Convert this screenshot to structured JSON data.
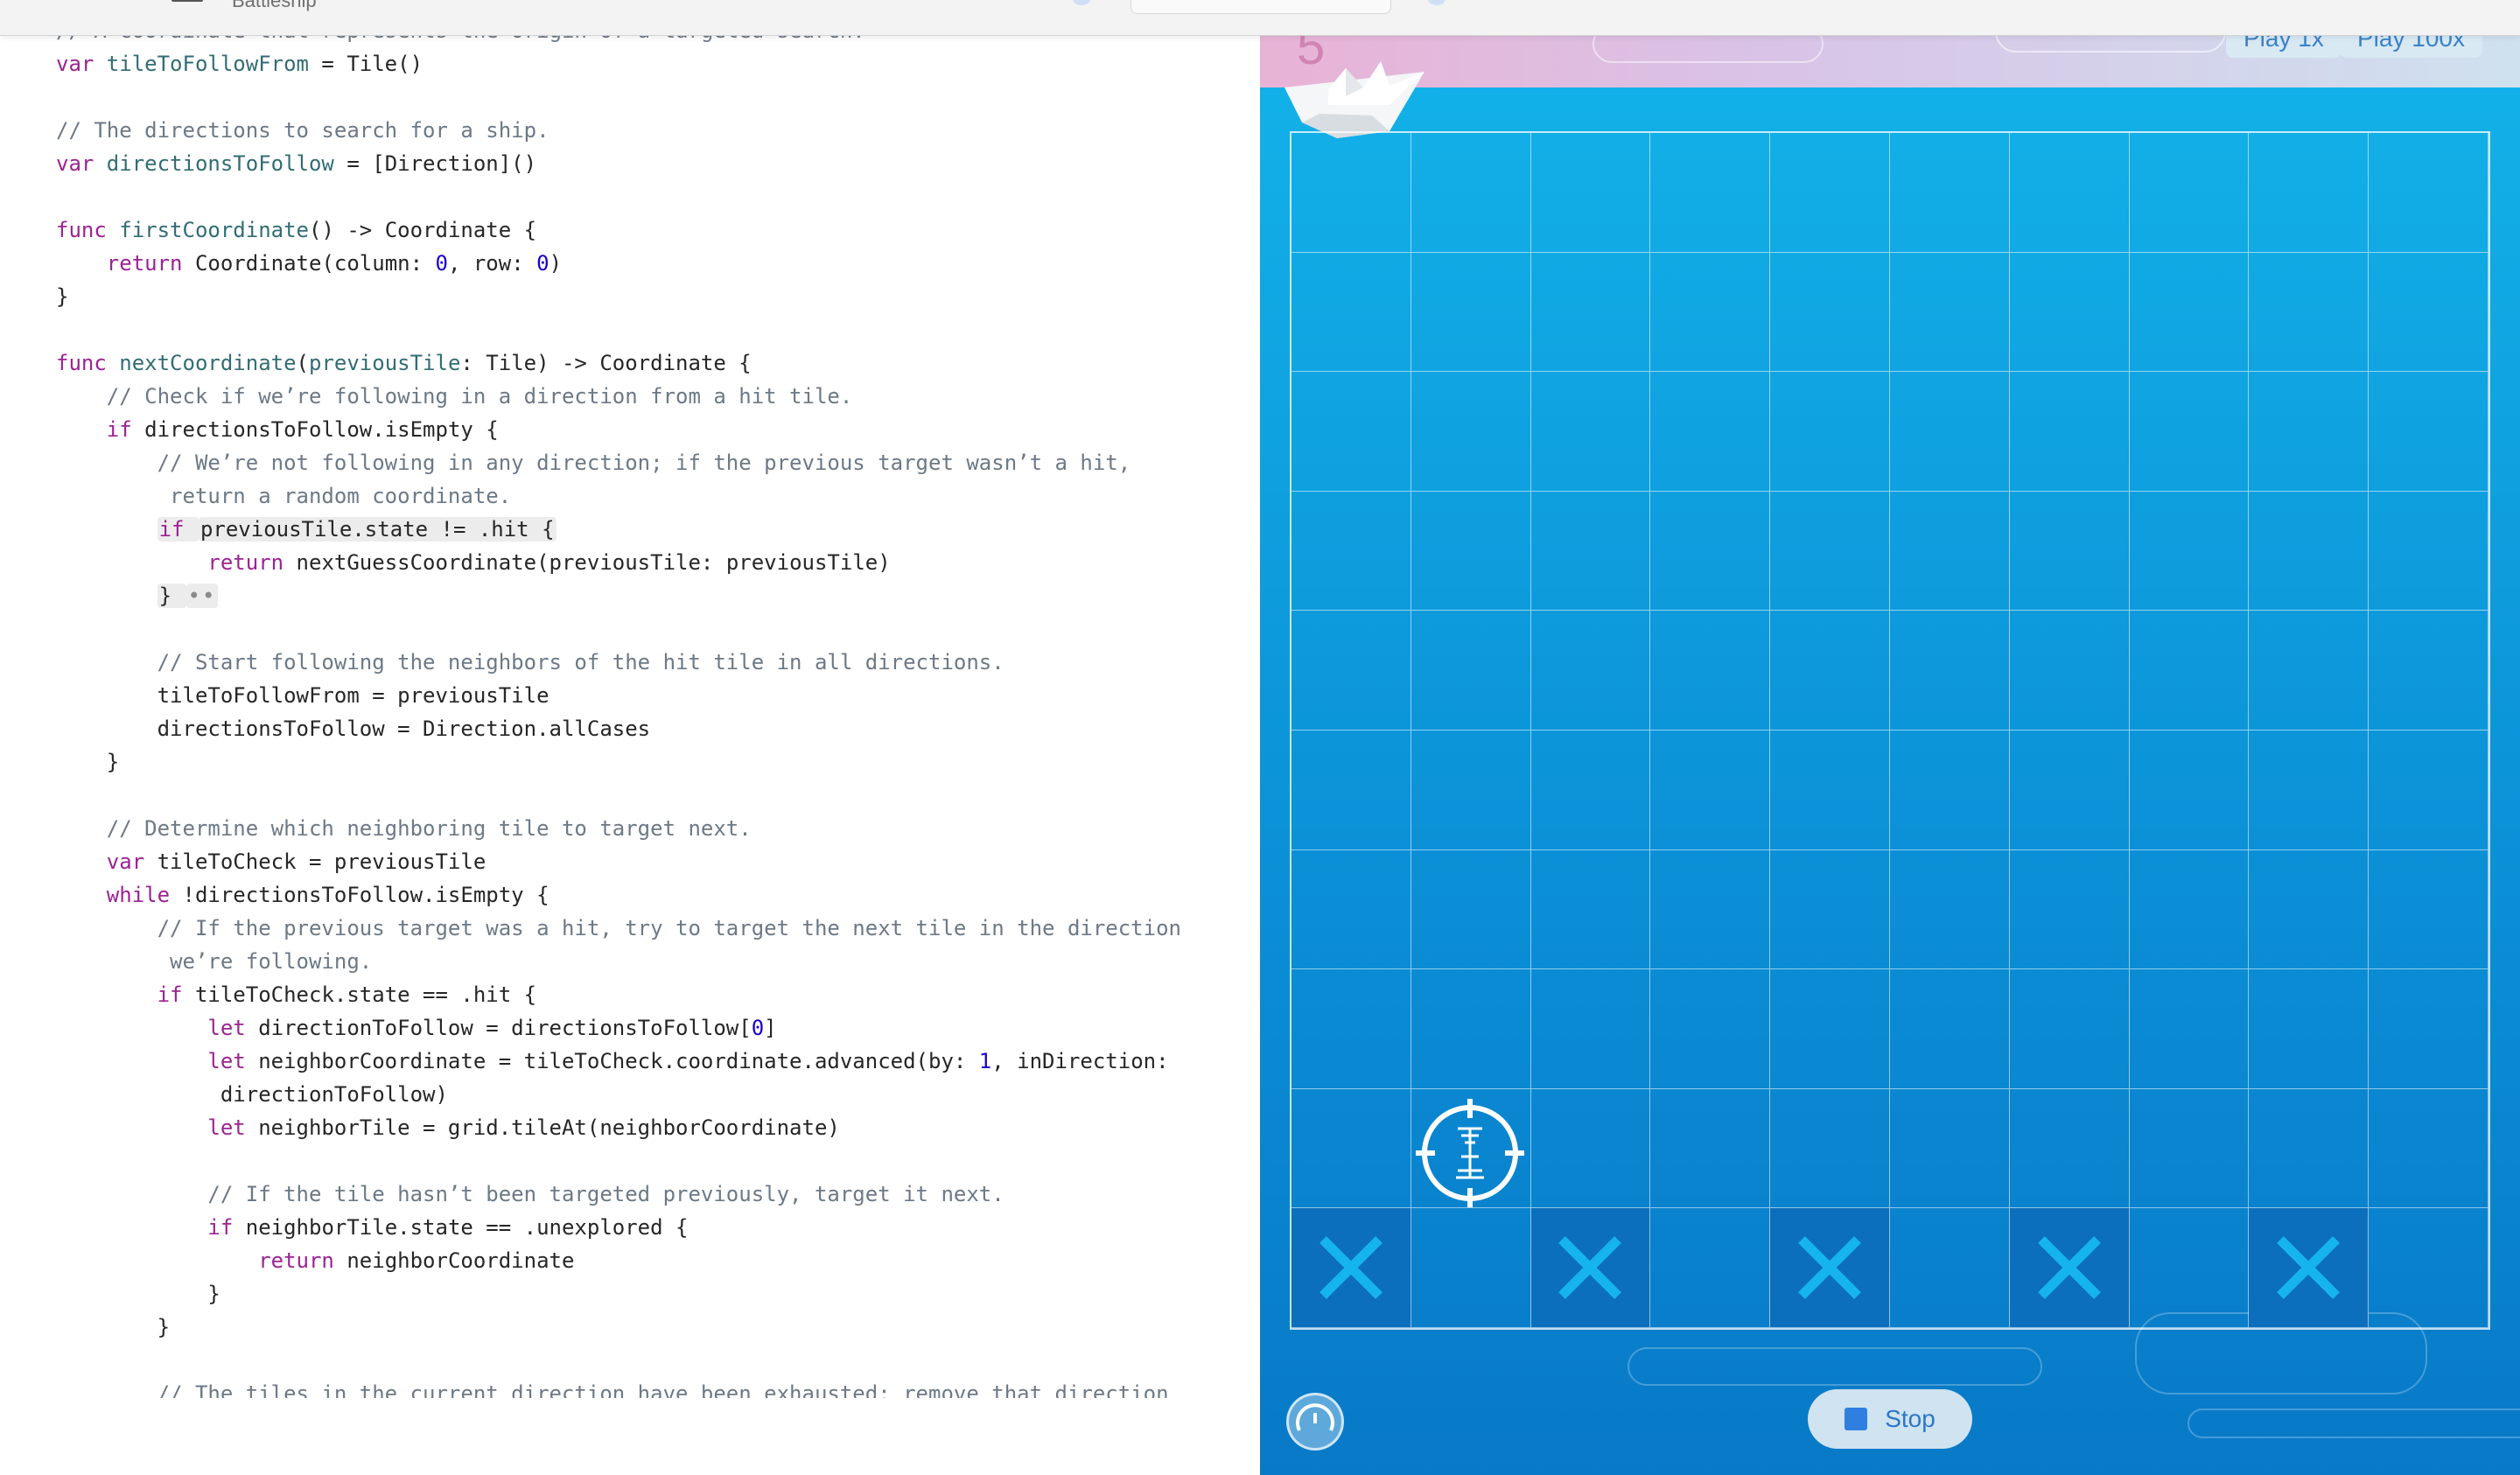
{
  "window": {
    "title": "Battleship"
  },
  "editor": {
    "lines": [
      [
        {
          "t": "// A coordinate that represents the origin of a targeted search.",
          "c": "c"
        }
      ],
      [
        {
          "t": "var ",
          "c": "k"
        },
        {
          "t": "tileToFollowFrom",
          "c": "fn"
        },
        {
          "t": " = Tile()",
          "c": ""
        }
      ],
      [],
      [
        {
          "t": "// The directions to search for a ship.",
          "c": "c"
        }
      ],
      [
        {
          "t": "var ",
          "c": "k"
        },
        {
          "t": "directionsToFollow",
          "c": "fn"
        },
        {
          "t": " = [Direction]()",
          "c": ""
        }
      ],
      [],
      [
        {
          "t": "func ",
          "c": "k"
        },
        {
          "t": "firstCoordinate",
          "c": "fn"
        },
        {
          "t": "() -> Coordinate {",
          "c": ""
        }
      ],
      [
        {
          "t": "    ",
          "c": ""
        },
        {
          "t": "return ",
          "c": "k"
        },
        {
          "t": "Coordinate(column: ",
          "c": ""
        },
        {
          "t": "0",
          "c": "n"
        },
        {
          "t": ", row: ",
          "c": ""
        },
        {
          "t": "0",
          "c": "n"
        },
        {
          "t": ")",
          "c": ""
        }
      ],
      [
        {
          "t": "}",
          "c": ""
        }
      ],
      [],
      [
        {
          "t": "func ",
          "c": "k"
        },
        {
          "t": "nextCoordinate",
          "c": "fn"
        },
        {
          "t": "(",
          "c": ""
        },
        {
          "t": "previousTile",
          "c": "fn"
        },
        {
          "t": ": Tile) -> Coordinate {",
          "c": ""
        }
      ],
      [
        {
          "t": "    // Check if we’re following in a direction from a hit tile.",
          "c": "c"
        }
      ],
      [
        {
          "t": "    ",
          "c": ""
        },
        {
          "t": "if ",
          "c": "k"
        },
        {
          "t": "directionsToFollow.isEmpty {",
          "c": ""
        }
      ],
      [
        {
          "t": "        // We’re not following in any direction; if the previous target wasn’t a hit,",
          "c": "c"
        }
      ],
      [
        {
          "t": "         return a random coordinate.",
          "c": "c"
        }
      ],
      [
        {
          "t": "        ",
          "c": ""
        },
        {
          "t": "if ",
          "c": "k hl"
        },
        {
          "t": "previousTile.state != .hit {",
          "c": "hl"
        }
      ],
      [
        {
          "t": "            ",
          "c": ""
        },
        {
          "t": "return ",
          "c": "k"
        },
        {
          "t": "nextGuessCoordinate(previousTile: previousTile)",
          "c": ""
        }
      ],
      [
        {
          "t": "        ",
          "c": ""
        },
        {
          "t": "} ",
          "c": "hl"
        },
        {
          "t": "••",
          "c": "dots hl"
        }
      ],
      [],
      [
        {
          "t": "        // Start following the neighbors of the hit tile in all directions.",
          "c": "c"
        }
      ],
      [
        {
          "t": "        tileToFollowFrom = previousTile",
          "c": ""
        }
      ],
      [
        {
          "t": "        directionsToFollow = Direction.allCases",
          "c": ""
        }
      ],
      [
        {
          "t": "    }",
          "c": ""
        }
      ],
      [],
      [
        {
          "t": "    // Determine which neighboring tile to target next.",
          "c": "c"
        }
      ],
      [
        {
          "t": "    ",
          "c": ""
        },
        {
          "t": "var ",
          "c": "k"
        },
        {
          "t": "tileToCheck = previousTile",
          "c": ""
        }
      ],
      [
        {
          "t": "    ",
          "c": ""
        },
        {
          "t": "while ",
          "c": "k"
        },
        {
          "t": "!directionsToFollow.isEmpty {",
          "c": ""
        }
      ],
      [
        {
          "t": "        // If the previous target was a hit, try to target the next tile in the direction",
          "c": "c"
        }
      ],
      [
        {
          "t": "         we’re following.",
          "c": "c"
        }
      ],
      [
        {
          "t": "        ",
          "c": ""
        },
        {
          "t": "if ",
          "c": "k"
        },
        {
          "t": "tileToCheck.state == .hit {",
          "c": ""
        }
      ],
      [
        {
          "t": "            ",
          "c": ""
        },
        {
          "t": "let ",
          "c": "k"
        },
        {
          "t": "directionToFollow = directionsToFollow[",
          "c": ""
        },
        {
          "t": "0",
          "c": "n"
        },
        {
          "t": "]",
          "c": ""
        }
      ],
      [
        {
          "t": "            ",
          "c": ""
        },
        {
          "t": "let ",
          "c": "k"
        },
        {
          "t": "neighborCoordinate = tileToCheck.coordinate.advanced(by: ",
          "c": ""
        },
        {
          "t": "1",
          "c": "n"
        },
        {
          "t": ", inDirection:",
          "c": ""
        }
      ],
      [
        {
          "t": "             directionToFollow)",
          "c": ""
        }
      ],
      [
        {
          "t": "            ",
          "c": ""
        },
        {
          "t": "let ",
          "c": "k"
        },
        {
          "t": "neighborTile = grid.tileAt(neighborCoordinate)",
          "c": ""
        }
      ],
      [],
      [
        {
          "t": "            // If the tile hasn’t been targeted previously, target it next.",
          "c": "c"
        }
      ],
      [
        {
          "t": "            ",
          "c": ""
        },
        {
          "t": "if ",
          "c": "k"
        },
        {
          "t": "neighborTile.state == .unexplored {",
          "c": ""
        }
      ],
      [
        {
          "t": "                ",
          "c": ""
        },
        {
          "t": "return ",
          "c": "k"
        },
        {
          "t": "neighborCoordinate",
          "c": ""
        }
      ],
      [
        {
          "t": "            }",
          "c": ""
        }
      ],
      [
        {
          "t": "        }",
          "c": ""
        }
      ],
      [],
      [
        {
          "t": "        // The tiles in the current direction have been exhausted; remove that direction",
          "c": "c"
        }
      ]
    ]
  },
  "live_view": {
    "count": "5",
    "play_1x_label": "Play 1x",
    "play_100x_label": "Play 100x",
    "stop_label": "Stop",
    "grid_rows": 10,
    "grid_cols": 10,
    "misses": [
      [
        9,
        0
      ],
      [
        9,
        2
      ],
      [
        9,
        4
      ],
      [
        9,
        6
      ],
      [
        9,
        8
      ]
    ],
    "target": [
      8,
      1
    ],
    "colors": {
      "sea_top": "#13b4ea",
      "sea_bottom": "#0879c7",
      "miss_cell": "#0b6fbd",
      "miss_x": "#16b4ef"
    }
  }
}
